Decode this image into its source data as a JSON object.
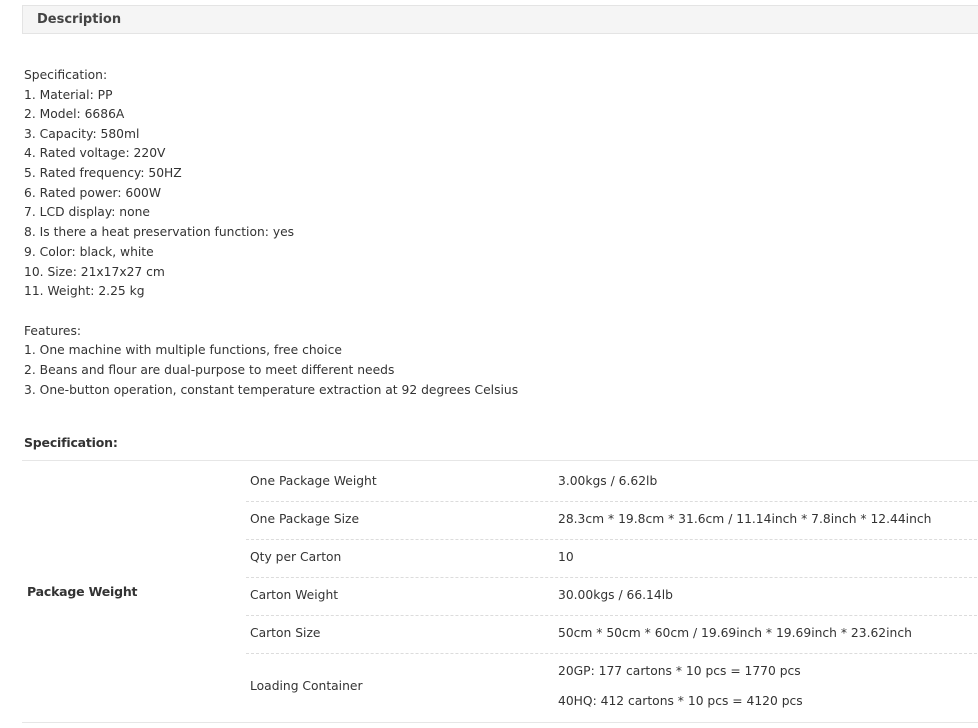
{
  "tab": {
    "label": "Description"
  },
  "description": {
    "lines": [
      "Specification:",
      "1. Material: PP",
      "2. Model: 6686A",
      "3. Capacity: 580ml",
      "4. Rated voltage: 220V",
      "5. Rated frequency: 50HZ",
      "6. Rated power: 600W",
      "7. LCD display: none",
      "8. Is there a heat preservation function: yes",
      "9. Color: black, white",
      "10. Size: 21x17x27 cm",
      "11. Weight: 2.25 kg",
      "",
      "Features:",
      "1. One machine with multiple functions, free choice",
      "2. Beans and flour are dual-purpose to meet different needs",
      "3. One-button operation, constant temperature extraction at 92 degrees Celsius"
    ]
  },
  "spec_table": {
    "heading": "Specification:",
    "group_label": "Package Weight",
    "rows": [
      {
        "name": "One Package Weight",
        "value": "3.00kgs / 6.62lb"
      },
      {
        "name": "One Package Size",
        "value": "28.3cm * 19.8cm * 31.6cm / 11.14inch * 7.8inch * 12.44inch"
      },
      {
        "name": "Qty per Carton",
        "value": "10"
      },
      {
        "name": "Carton Weight",
        "value": "30.00kgs / 66.14lb"
      },
      {
        "name": "Carton Size",
        "value": "50cm * 50cm * 60cm / 19.69inch * 19.69inch * 23.62inch"
      },
      {
        "name": "Loading Container",
        "value": "20GP: 177 cartons * 10 pcs = 1770 pcs",
        "value2": "40HQ: 412 cartons * 10 pcs = 4120 pcs"
      }
    ]
  }
}
